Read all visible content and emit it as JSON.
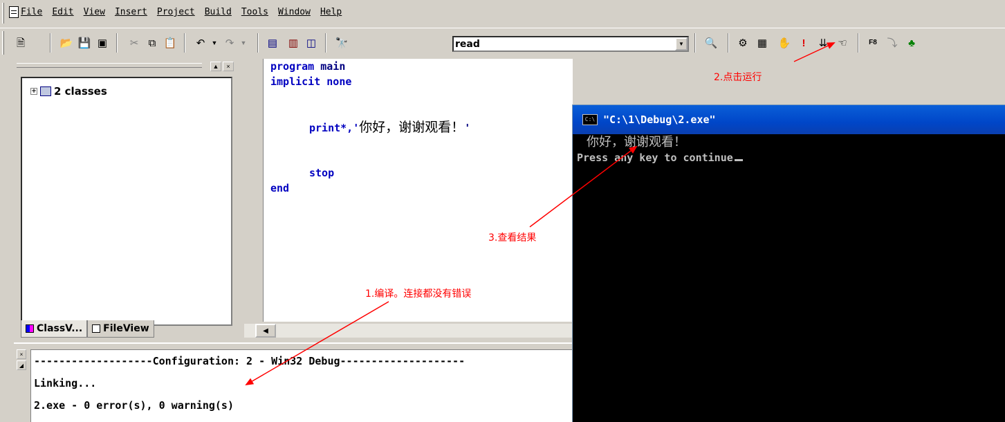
{
  "menu": {
    "items": [
      "File",
      "Edit",
      "View",
      "Insert",
      "Project",
      "Build",
      "Tools",
      "Window",
      "Help"
    ]
  },
  "toolbar": {
    "find_value": "read",
    "tools": [
      "new-file-icon",
      "open-icon",
      "save-icon",
      "save-all-icon",
      "cut-icon",
      "copy-icon",
      "paste-icon",
      "undo-icon",
      "redo-icon",
      "workspace-icon",
      "output-icon",
      "windows-icon",
      "find-in-files-icon",
      "find-icon",
      "compile-icon",
      "build-icon",
      "stop-build-icon",
      "execute-icon",
      "go-icon",
      "breakpoint-icon",
      "help-icon",
      "step-icon"
    ]
  },
  "classview": {
    "root_label": "2 classes",
    "tab_class": "ClassV...",
    "tab_file": "FileView"
  },
  "editor": {
    "lines": {
      "l1_kw": "program",
      "l1_rest": "main",
      "l2": "implicit none",
      "l3_kw": "print*,'",
      "l3_text": "你好，谢谢观看！",
      "l3_end": "'",
      "l4": "stop",
      "l5": "end"
    }
  },
  "output": {
    "line1": "-------------------Configuration: 2 - Win32 Debug--------------------",
    "line2": "Linking...",
    "line3": "",
    "line4": "2.exe - 0 error(s), 0 warning(s)"
  },
  "console": {
    "title": "\"C:\\1\\Debug\\2.exe\"",
    "icon_text": "C:\\",
    "line1": "你好，谢谢观看！",
    "line2": "Press any key to continue"
  },
  "annotations": {
    "step1": "1.编译。连接都没有错误",
    "step2": "2.点击运行",
    "step3": "3.查看结果"
  },
  "colors": {
    "annotation": "#ff0000",
    "title_bar": "#0046c8",
    "keyword": "#0000c0",
    "console_bg": "#000000"
  }
}
